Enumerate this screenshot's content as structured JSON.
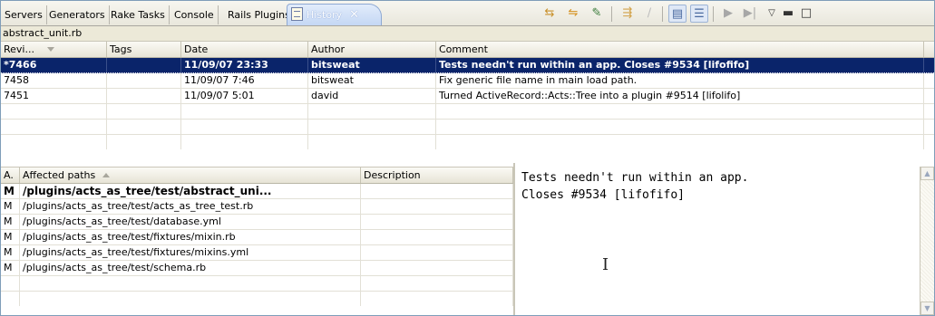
{
  "tabs": [
    {
      "label": "Servers"
    },
    {
      "label": "Generators"
    },
    {
      "label": "Rake Tasks"
    },
    {
      "label": "Console"
    },
    {
      "label": "Rails Plugins"
    },
    {
      "label": "History",
      "active": true
    }
  ],
  "toolbar": {
    "icons": [
      "link-with-editor-icon",
      "compare-icon",
      "get-contents-icon",
      "expand-all-icon",
      "edit-icon",
      "show-comment-icon",
      "show-paths-icon",
      "play-icon",
      "step-icon",
      "view-menu-icon",
      "minimize-icon",
      "maximize-icon"
    ]
  },
  "file_label": "abstract_unit.rb",
  "history": {
    "columns": [
      "Revi...",
      "Tags",
      "Date",
      "Author",
      "Comment"
    ],
    "rows": [
      {
        "revision": "*7466",
        "tags": "",
        "date": "11/09/07 23:33",
        "author": "bitsweat",
        "comment": "Tests needn't run within an app. Closes #9534 [lifofifo]",
        "selected": true
      },
      {
        "revision": "7458",
        "tags": "",
        "date": "11/09/07 7:46",
        "author": "bitsweat",
        "comment": "Fix generic file name in main load path.",
        "selected": false
      },
      {
        "revision": "7451",
        "tags": "",
        "date": "11/09/07 5:01",
        "author": "david",
        "comment": "Turned ActiveRecord::Acts::Tree into a plugin #9514 [lifolifo]",
        "selected": false
      }
    ]
  },
  "paths": {
    "columns": [
      "A.",
      "Affected paths",
      "Description"
    ],
    "rows": [
      {
        "action": "M",
        "path": "/plugins/acts_as_tree/test/abstract_uni...",
        "description": "",
        "bold": true
      },
      {
        "action": "M",
        "path": "/plugins/acts_as_tree/test/acts_as_tree_test.rb",
        "description": ""
      },
      {
        "action": "M",
        "path": "/plugins/acts_as_tree/test/database.yml",
        "description": ""
      },
      {
        "action": "M",
        "path": "/plugins/acts_as_tree/test/fixtures/mixin.rb",
        "description": ""
      },
      {
        "action": "M",
        "path": "/plugins/acts_as_tree/test/fixtures/mixins.yml",
        "description": ""
      },
      {
        "action": "M",
        "path": "/plugins/acts_as_tree/test/schema.rb",
        "description": ""
      }
    ]
  },
  "comment_text": {
    "line1": "Tests needn't run within an app.",
    "line2": "Closes #9534 [lifofifo]"
  },
  "colors": {
    "selection": "#0a246a",
    "active_tab": "#c4d7f4"
  }
}
